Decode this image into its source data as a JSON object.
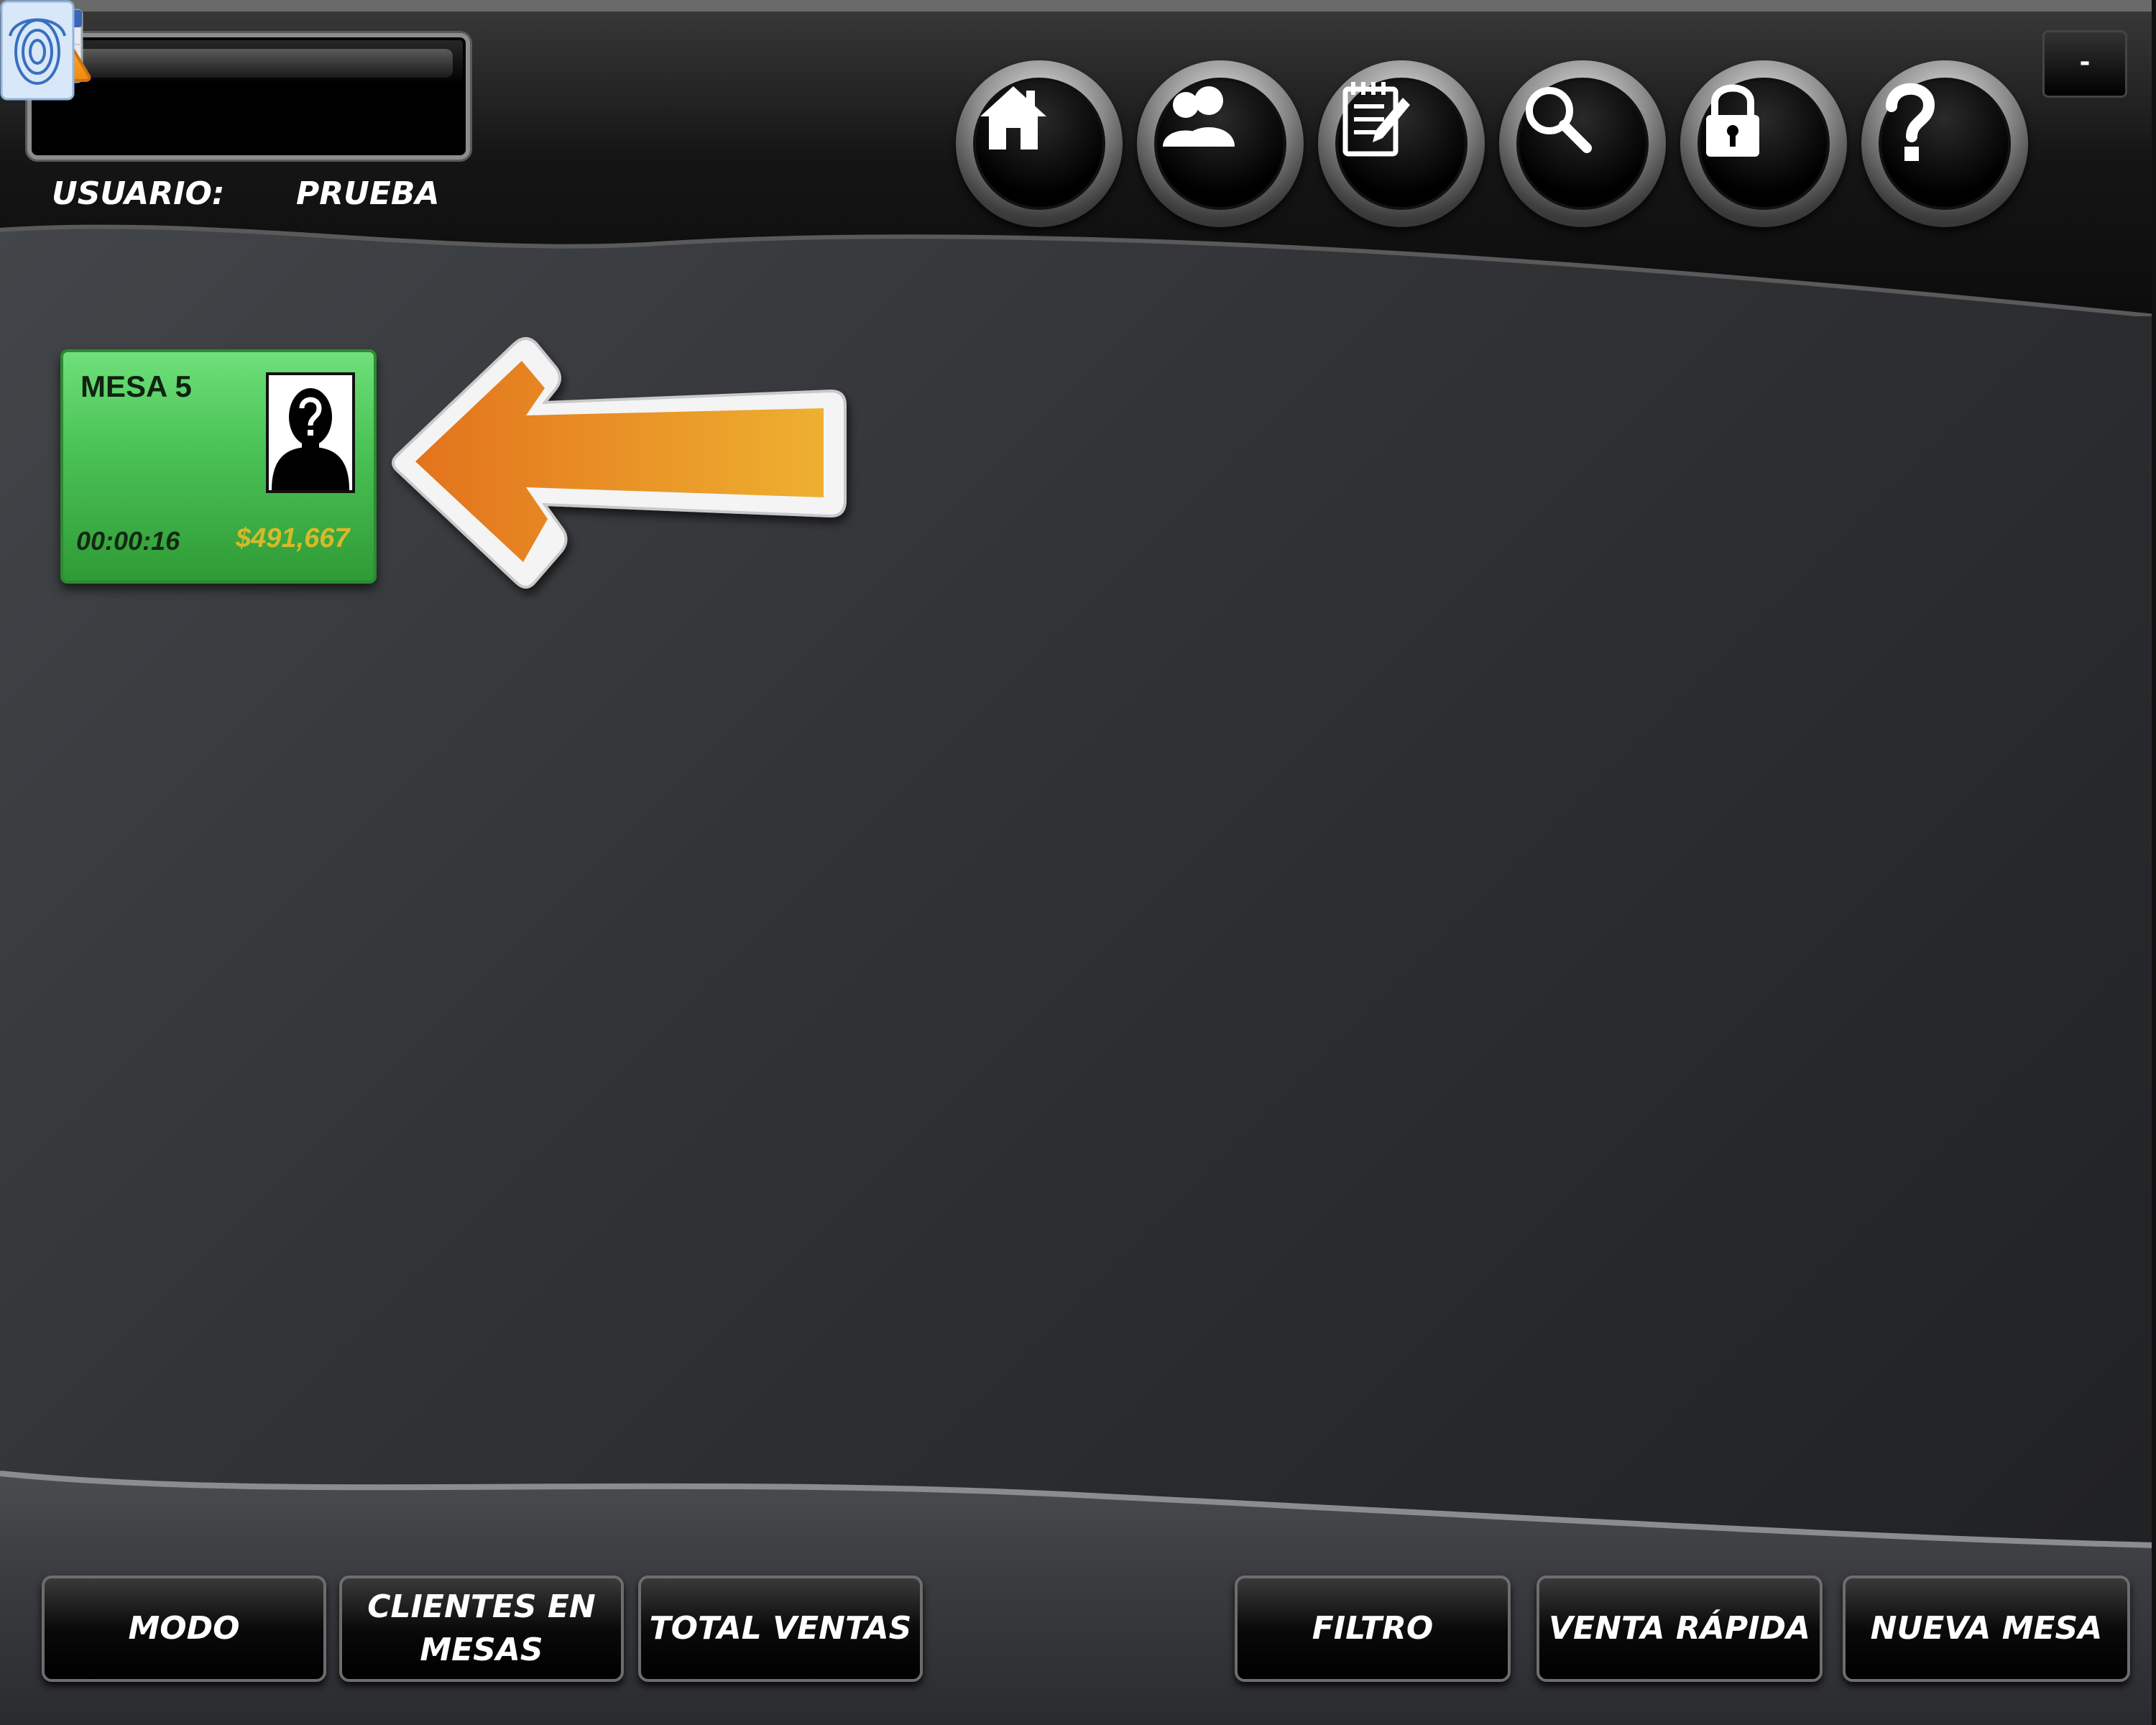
{
  "header": {
    "display_value": "",
    "user_label": "USUARIO:",
    "user_value": "PRUEBA",
    "minimize_label": "-"
  },
  "nav_icons": [
    "home-icon",
    "users-icon",
    "notes-edit-icon",
    "search-icon",
    "lock-icon",
    "help-icon"
  ],
  "tables": [
    {
      "name": "MESA 5",
      "time": "00:00:16",
      "total": "$491,667",
      "status_color": "#4cc457"
    }
  ],
  "footer": {
    "buttons": [
      {
        "label": "MODO"
      },
      {
        "label": "CLIENTES EN\nMESAS"
      },
      {
        "label": "TOTAL VENTAS"
      },
      {
        "label": "FILTRO"
      },
      {
        "label": "VENTA RÁPIDA"
      },
      {
        "label": "NUEVA MESA"
      }
    ]
  },
  "colors": {
    "accent_orange": "#e8821e",
    "table_green": "#4cc457",
    "total_gold": "#d8b92a"
  }
}
